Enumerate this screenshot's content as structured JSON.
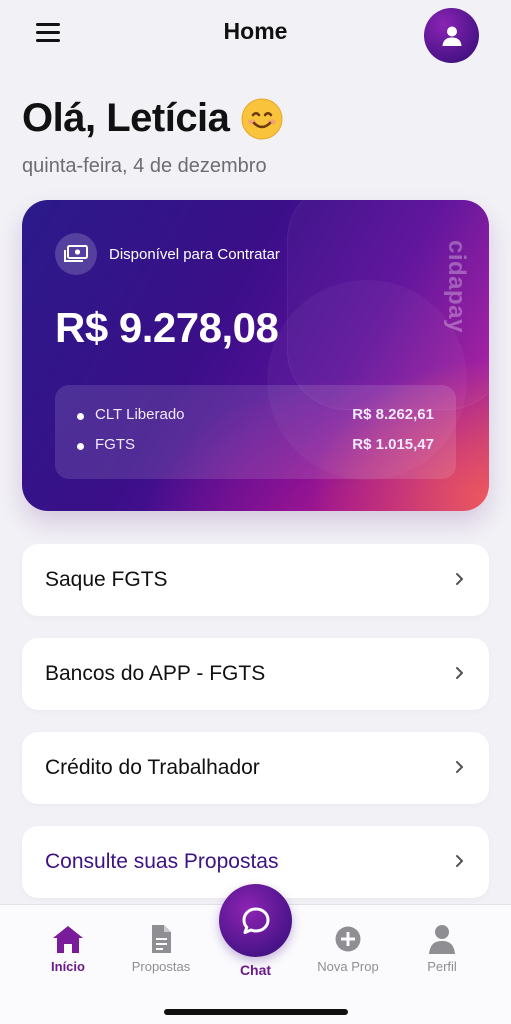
{
  "header": {
    "title": "Home",
    "menu_icon": "hamburger-menu-icon",
    "avatar_icon": "user-icon"
  },
  "greeting": {
    "text": "Olá, Letícia",
    "emoji_icon": "smiling-face-emoji-icon",
    "date": "quinta-feira, 4 de dezembro"
  },
  "card": {
    "label": "Disponível para Contratar",
    "amount": "R$ 9.278,08",
    "brand": "cidapay",
    "items": [
      {
        "name": "CLT Liberado",
        "value": "R$ 8.262,61"
      },
      {
        "name": "FGTS",
        "value": "R$ 1.015,47"
      }
    ],
    "colors": {
      "start": "#2b1a8a",
      "mid": "#5c0f9a",
      "end": "#f05a5a"
    }
  },
  "menu": [
    {
      "label": "Saque FGTS"
    },
    {
      "label": "Bancos do APP - FGTS"
    },
    {
      "label": "Crédito do Trabalhador"
    },
    {
      "label": "Consulte suas Propostas"
    }
  ],
  "tabbar": {
    "items": [
      {
        "label": "Início",
        "icon": "home-icon",
        "active": true
      },
      {
        "label": "Propostas",
        "icon": "document-icon",
        "active": false
      },
      {
        "label": "Chat",
        "icon": "chat-bubble-icon",
        "active": false
      },
      {
        "label": "Nova Prop",
        "icon": "plus-circle-icon",
        "active": false
      },
      {
        "label": "Perfil",
        "icon": "person-icon",
        "active": false
      }
    ],
    "accent": "#6b1a8c"
  }
}
